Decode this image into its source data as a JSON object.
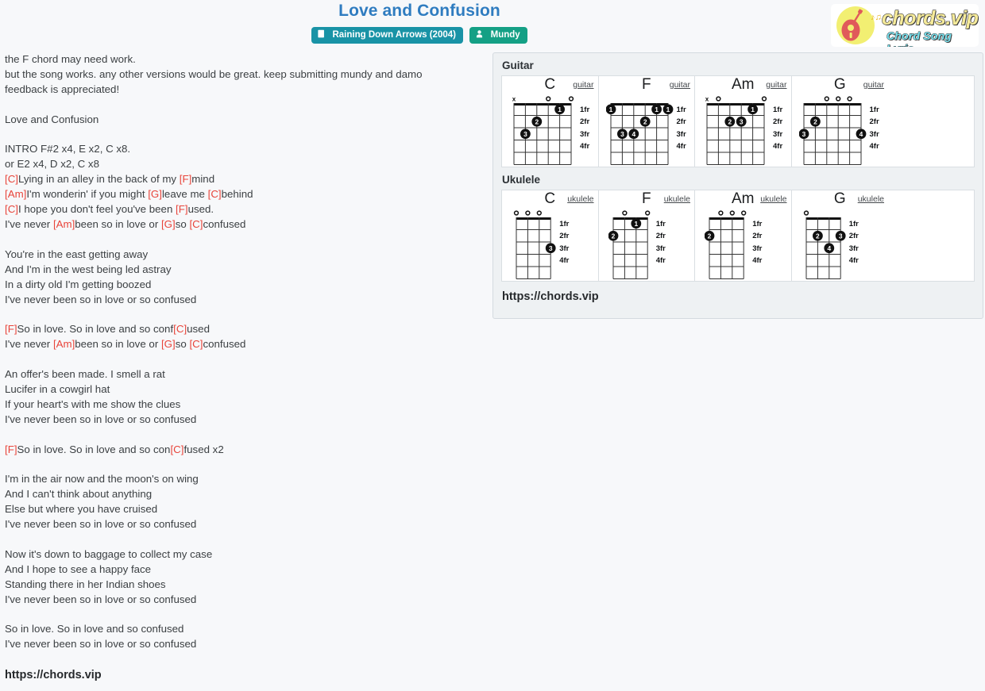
{
  "header": {
    "title": "Love and Confusion",
    "album_badge": "Raining Down Arrows (2004)",
    "artist_badge": "Mundy",
    "album_icon": "book-icon",
    "artist_icon": "user-icon",
    "logo": {
      "wordmark": "chords.vip",
      "tagline": "Chord Song Lyric",
      "circle_color": "#f2ef72",
      "guitar_color": "#e05a5a",
      "wordmark_color": "#f6eb9a",
      "tagline_color": "#79e2ef"
    },
    "title_color": "#2f7cc0",
    "album_badge_color": "#1993a6",
    "artist_badge_color": "#14a085"
  },
  "lyrics": {
    "chord_color": "#e8443a",
    "url": "https://chords.vip",
    "lines": [
      [
        {
          "t": "the F chord may need work."
        }
      ],
      [
        {
          "t": "but the song works. any other versions would be great. keep submitting mundy and damo"
        }
      ],
      [
        {
          "t": "feedback is appreciated!"
        }
      ],
      [],
      [
        {
          "t": "Love and Confusion"
        }
      ],
      [],
      [
        {
          "t": "INTRO F#2 x4, E x2, C x8."
        }
      ],
      [
        {
          "t": "or E2 x4, D x2, C x8"
        }
      ],
      [
        {
          "t": "[C]",
          "c": true
        },
        {
          "t": "Lying in an alley in the back of my "
        },
        {
          "t": "[F]",
          "c": true
        },
        {
          "t": "mind"
        }
      ],
      [
        {
          "t": "[Am]",
          "c": true
        },
        {
          "t": "I'm wonderin' if you might "
        },
        {
          "t": "[G]",
          "c": true
        },
        {
          "t": "leave me "
        },
        {
          "t": "[C]",
          "c": true
        },
        {
          "t": "behind"
        }
      ],
      [
        {
          "t": "[C]",
          "c": true
        },
        {
          "t": "I hope you don't feel you've been "
        },
        {
          "t": "[F]",
          "c": true
        },
        {
          "t": "used."
        }
      ],
      [
        {
          "t": "I've never "
        },
        {
          "t": "[Am]",
          "c": true
        },
        {
          "t": "been so in love or "
        },
        {
          "t": "[G]",
          "c": true
        },
        {
          "t": "so "
        },
        {
          "t": "[C]",
          "c": true
        },
        {
          "t": "confused"
        }
      ],
      [],
      [
        {
          "t": "You're in the east getting away"
        }
      ],
      [
        {
          "t": "And I'm in the west being led astray"
        }
      ],
      [
        {
          "t": "In a dirty old I'm getting boozed"
        }
      ],
      [
        {
          "t": "I've never been so in love or so confused"
        }
      ],
      [],
      [
        {
          "t": "[F]",
          "c": true
        },
        {
          "t": "So in love. So in love and so conf"
        },
        {
          "t": "[C]",
          "c": true
        },
        {
          "t": "used"
        }
      ],
      [
        {
          "t": "I've never "
        },
        {
          "t": "[Am]",
          "c": true
        },
        {
          "t": "been so in love or "
        },
        {
          "t": "[G]",
          "c": true
        },
        {
          "t": "so "
        },
        {
          "t": "[C]",
          "c": true
        },
        {
          "t": "confused"
        }
      ],
      [],
      [
        {
          "t": "An offer's been made. I smell a rat"
        }
      ],
      [
        {
          "t": "Lucifer in a cowgirl hat"
        }
      ],
      [
        {
          "t": "If your heart's with me show the clues"
        }
      ],
      [
        {
          "t": "I've never been so in love or so confused"
        }
      ],
      [],
      [
        {
          "t": "[F]",
          "c": true
        },
        {
          "t": "So in love. So in love and so con"
        },
        {
          "t": "[C]",
          "c": true
        },
        {
          "t": "fused x2"
        }
      ],
      [],
      [
        {
          "t": "I'm in the air now and the moon's on wing"
        }
      ],
      [
        {
          "t": "And I can't think about anything"
        }
      ],
      [
        {
          "t": "Else but where you have cruised"
        }
      ],
      [
        {
          "t": "I've never been so in love or so confused"
        }
      ],
      [],
      [
        {
          "t": "Now it's down to baggage to collect my case"
        }
      ],
      [
        {
          "t": "And I hope to see a happy face"
        }
      ],
      [
        {
          "t": "Standing there in her Indian shoes"
        }
      ],
      [
        {
          "t": "I've never been so in love or so confused"
        }
      ],
      [],
      [
        {
          "t": "So in love. So in love and so confused"
        }
      ],
      [
        {
          "t": "I've never been so in love or so confused"
        }
      ]
    ]
  },
  "chords": {
    "guitar_section_label": "Guitar",
    "ukulele_section_label": "Ukulele",
    "fret_labels": [
      "1fr",
      "2fr",
      "3fr",
      "4fr"
    ],
    "panel_url": "https://chords.vip",
    "guitar_instrument_label": "guitar",
    "ukulele_instrument_label": "ukulele",
    "guitar": [
      {
        "name": "C",
        "instrument": "guitar",
        "strings": 6,
        "open_markers": [
          "x",
          "",
          "",
          "o",
          "",
          "o"
        ],
        "dots": [
          {
            "string": 5,
            "fret": 1,
            "finger": "1"
          },
          {
            "string": 3,
            "fret": 2,
            "finger": "2"
          },
          {
            "string": 2,
            "fret": 3,
            "finger": "3"
          }
        ]
      },
      {
        "name": "F",
        "instrument": "guitar",
        "strings": 6,
        "open_markers": [
          "",
          "",
          "",
          "",
          "",
          ""
        ],
        "dots": [
          {
            "string": 1,
            "fret": 1,
            "finger": "1"
          },
          {
            "string": 5,
            "fret": 1,
            "finger": "1"
          },
          {
            "string": 6,
            "fret": 1,
            "finger": "1"
          },
          {
            "string": 4,
            "fret": 2,
            "finger": "2"
          },
          {
            "string": 2,
            "fret": 3,
            "finger": "3"
          },
          {
            "string": 3,
            "fret": 3,
            "finger": "4"
          }
        ]
      },
      {
        "name": "Am",
        "instrument": "guitar",
        "strings": 6,
        "open_markers": [
          "x",
          "o",
          "",
          "",
          "",
          "o"
        ],
        "dots": [
          {
            "string": 5,
            "fret": 1,
            "finger": "1"
          },
          {
            "string": 3,
            "fret": 2,
            "finger": "2"
          },
          {
            "string": 4,
            "fret": 2,
            "finger": "3"
          }
        ]
      },
      {
        "name": "G",
        "instrument": "guitar",
        "strings": 6,
        "open_markers": [
          "",
          "",
          "o",
          "o",
          "o",
          ""
        ],
        "dots": [
          {
            "string": 2,
            "fret": 2,
            "finger": "2"
          },
          {
            "string": 1,
            "fret": 3,
            "finger": "3"
          },
          {
            "string": 6,
            "fret": 3,
            "finger": "4"
          }
        ]
      }
    ],
    "ukulele": [
      {
        "name": "C",
        "instrument": "ukulele",
        "strings": 4,
        "open_markers": [
          "o",
          "o",
          "o",
          ""
        ],
        "dots": [
          {
            "string": 4,
            "fret": 3,
            "finger": "3"
          }
        ]
      },
      {
        "name": "F",
        "instrument": "ukulele",
        "strings": 4,
        "open_markers": [
          "",
          "o",
          "",
          "o"
        ],
        "dots": [
          {
            "string": 3,
            "fret": 1,
            "finger": "1"
          },
          {
            "string": 1,
            "fret": 2,
            "finger": "2"
          }
        ]
      },
      {
        "name": "Am",
        "instrument": "ukulele",
        "strings": 4,
        "open_markers": [
          "",
          "o",
          "o",
          "o"
        ],
        "dots": [
          {
            "string": 1,
            "fret": 2,
            "finger": "2"
          }
        ]
      },
      {
        "name": "G",
        "instrument": "ukulele",
        "strings": 4,
        "open_markers": [
          "o",
          "",
          "",
          ""
        ],
        "dots": [
          {
            "string": 2,
            "fret": 2,
            "finger": "2"
          },
          {
            "string": 4,
            "fret": 2,
            "finger": "3"
          },
          {
            "string": 3,
            "fret": 3,
            "finger": "4"
          }
        ]
      }
    ]
  }
}
